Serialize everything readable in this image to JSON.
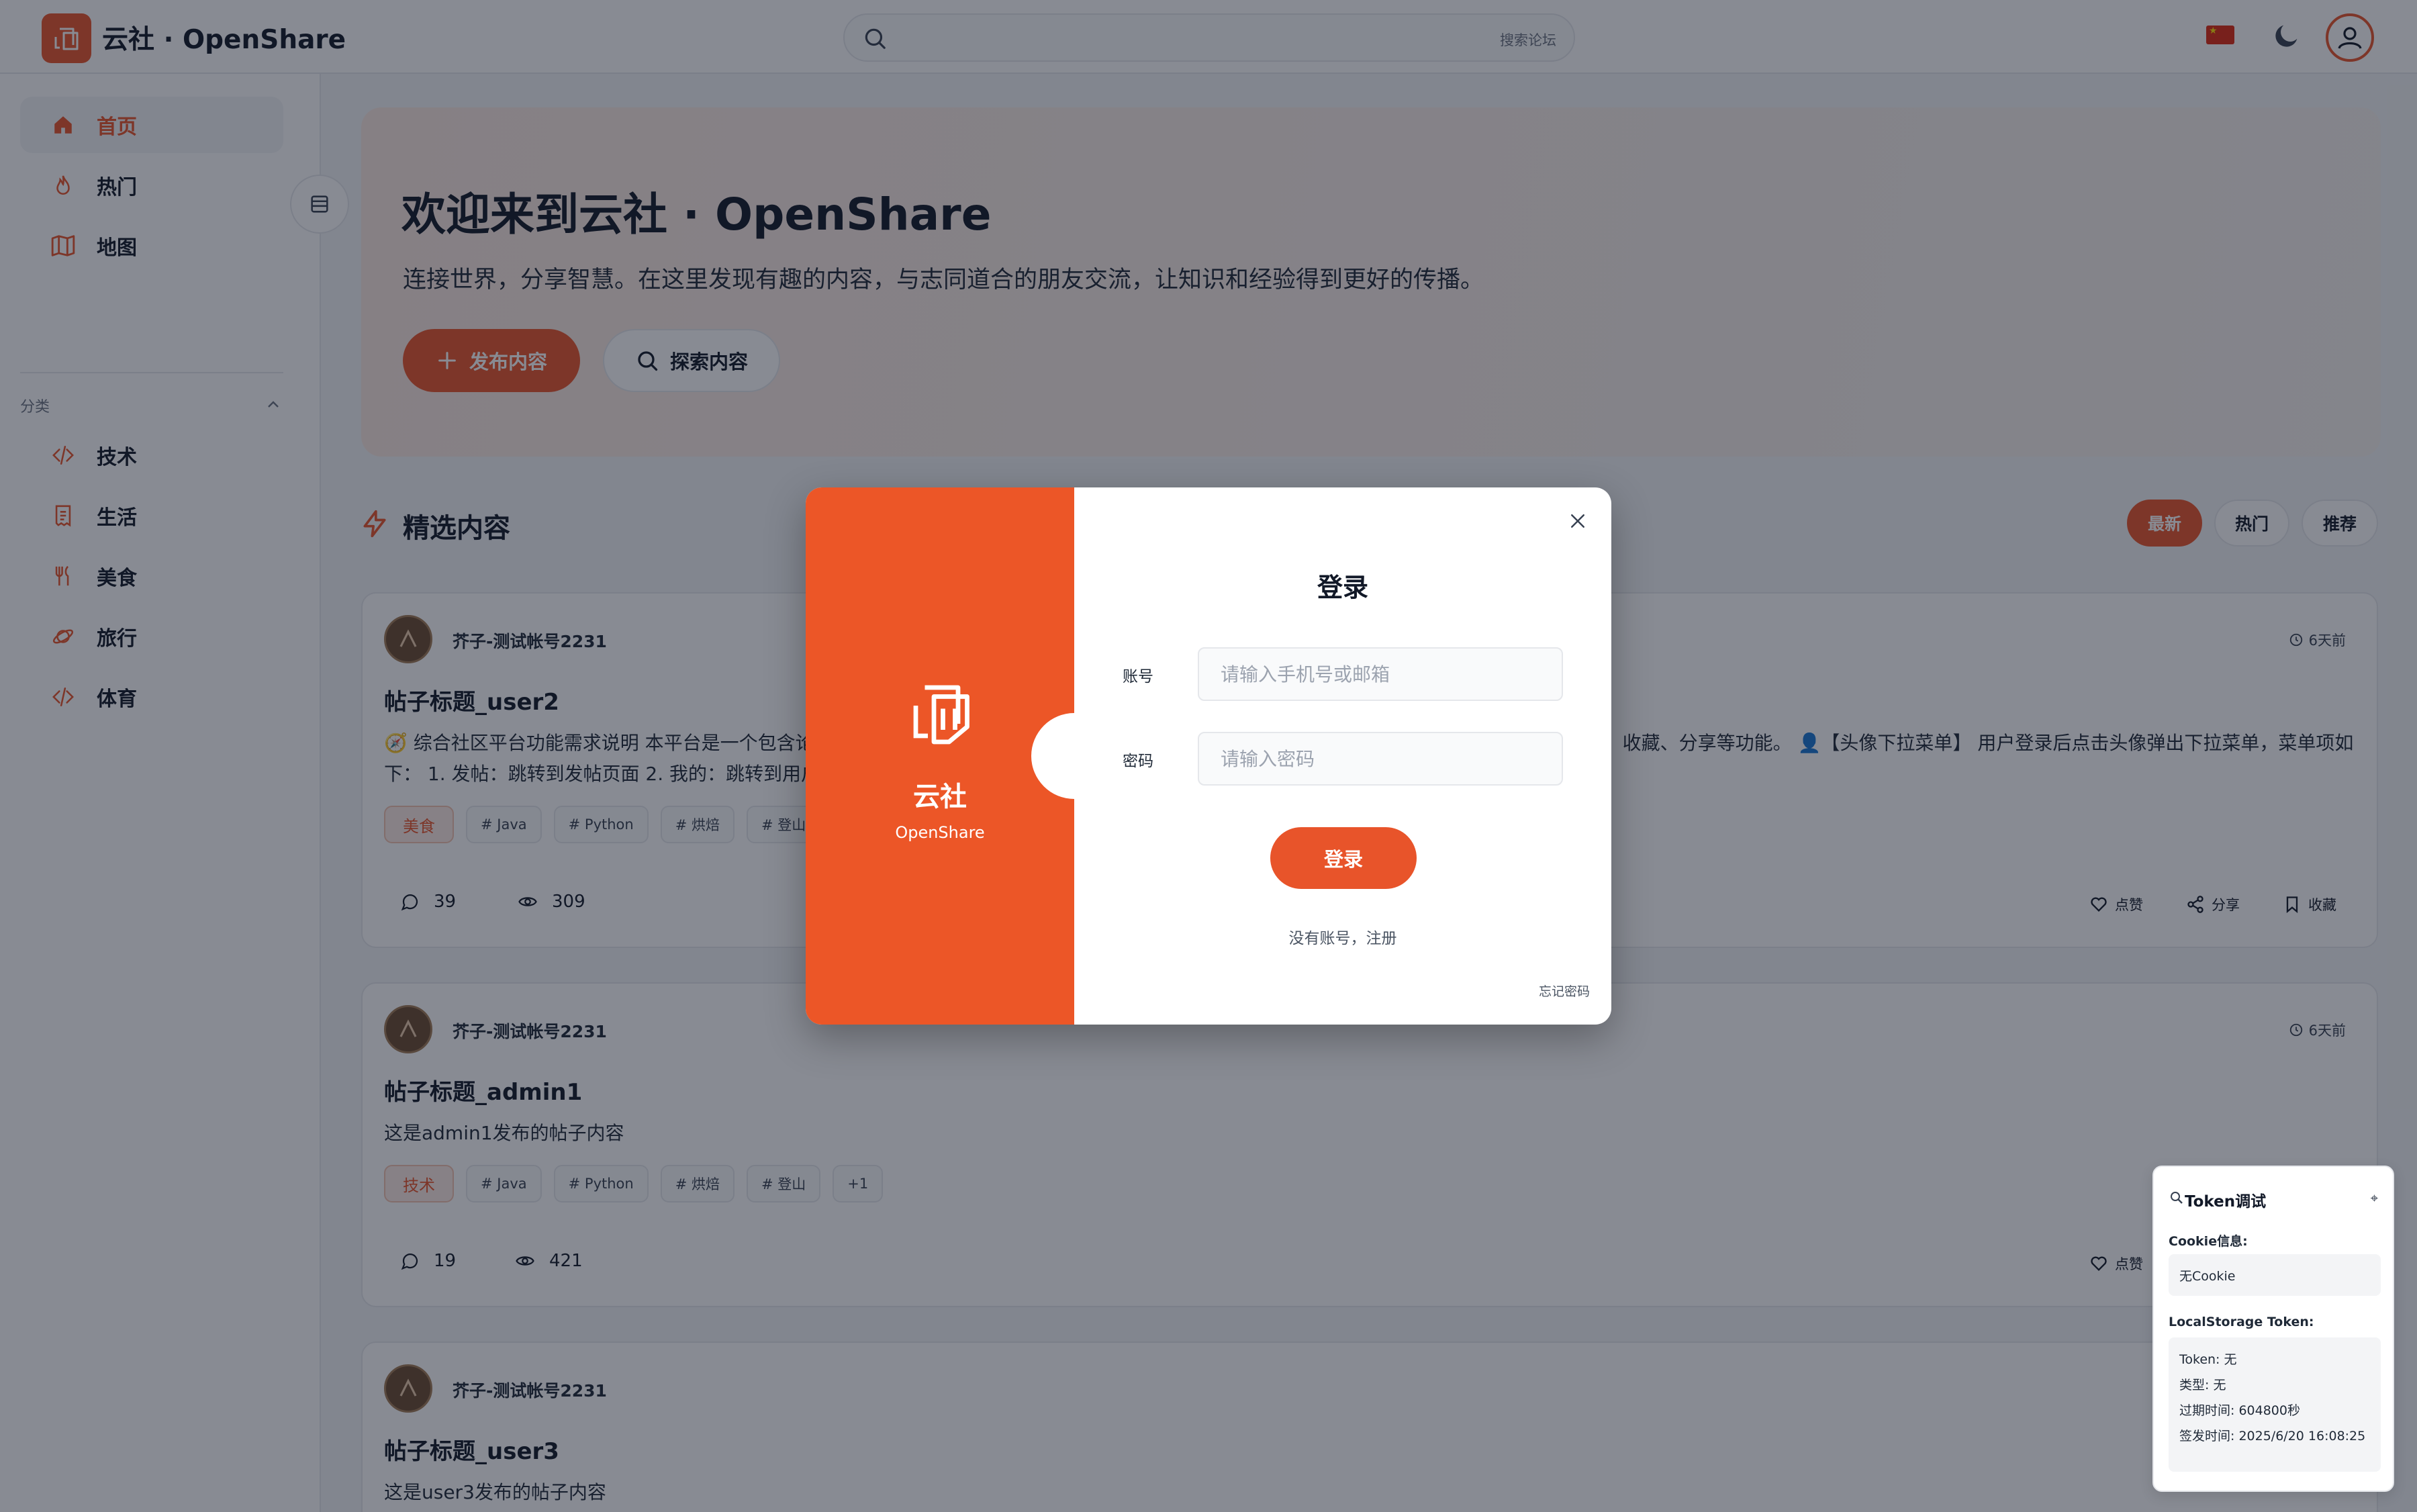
{
  "header": {
    "app_title": "云社 · OpenShare",
    "search_placeholder": "搜索论坛",
    "flag_icon": "cn-flag-icon",
    "theme_icon": "moon-icon",
    "avatar_icon": "user-icon"
  },
  "sidebar": {
    "nav": [
      {
        "label": "首页",
        "icon": "home-icon",
        "active": true
      },
      {
        "label": "热门",
        "icon": "flame-icon",
        "active": false
      },
      {
        "label": "地图",
        "icon": "map-icon",
        "active": false
      }
    ],
    "category_header": "分类",
    "categories": [
      {
        "label": "技术",
        "icon": "code-icon"
      },
      {
        "label": "生活",
        "icon": "receipt-icon"
      },
      {
        "label": "美食",
        "icon": "utensils-icon"
      },
      {
        "label": "旅行",
        "icon": "planet-icon"
      },
      {
        "label": "体育",
        "icon": "code-icon"
      }
    ]
  },
  "hero": {
    "title": "欢迎来到云社 · OpenShare",
    "subtitle": "连接世界，分享智慧。在这里发现有趣的内容，与志同道合的朋友交流，让知识和经验得到更好的传播。",
    "publish_label": "发布内容",
    "explore_label": "探索内容"
  },
  "feed": {
    "section_title": "精选内容",
    "tabs": [
      "最新",
      "热门",
      "推荐"
    ],
    "posts": [
      {
        "author": "芥子-测试帐号2231",
        "time": "6天前",
        "title": "帖子标题_user2",
        "body": "🧭 综合社区平台功能需求说明 本平台是一个包含论坛、内容发布、用户中心等多个模块的综合性社区平台，支持用户注册登录、发帖、评论、点赞、收藏、分享等功能。 👤【头像下拉菜单】 用户登录后点击头像弹出下拉菜单，菜单项如下： 1. 发帖：跳转到发帖页面 2. 我的：跳转到用户个人主页，...",
        "category": "美食",
        "tags": [
          "# Java",
          "# Python",
          "# 烘焙",
          "# 登山"
        ],
        "comments": "39",
        "views": "309",
        "like": "点赞",
        "share": "分享",
        "fav": "收藏"
      },
      {
        "author": "芥子-测试帐号2231",
        "time": "6天前",
        "title": "帖子标题_admin1",
        "body": "这是admin1发布的帖子内容",
        "category": "技术",
        "tags": [
          "# Java",
          "# Python",
          "# 烘焙",
          "# 登山",
          "+1"
        ],
        "comments": "19",
        "views": "421",
        "like": "点赞"
      },
      {
        "author": "芥子-测试帐号2231",
        "title": "帖子标题_user3",
        "body": "这是user3发布的帖子内容"
      }
    ]
  },
  "login_modal": {
    "brand": "云社",
    "brand_sub": "OpenShare",
    "title": "登录",
    "account_label": "账号",
    "account_placeholder": "请输入手机号或邮箱",
    "password_label": "密码",
    "password_placeholder": "请输入密码",
    "submit_label": "登录",
    "register_link": "没有账号，注册",
    "forgot_link": "忘记密码"
  },
  "token_panel": {
    "title": "Token调试",
    "cookie_label": "Cookie信息:",
    "cookie_value": "无Cookie",
    "ls_label": "LocalStorage Token:",
    "token_line": "Token: 无",
    "type_line": "类型: 无",
    "expire_line": "过期时间: 604800秒",
    "issued_line": "签发时间: 2025/6/20 16:08:25"
  },
  "colors": {
    "accent": "#e8542a",
    "modal_brand": "#ec5627"
  }
}
